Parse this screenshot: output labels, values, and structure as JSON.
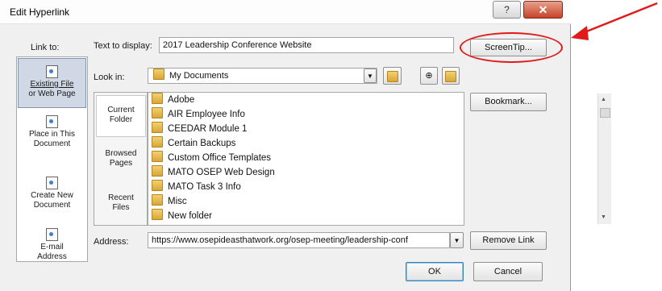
{
  "dialog": {
    "title": "Edit Hyperlink",
    "help_label": "?",
    "close_label": "✕"
  },
  "link_to": {
    "label": "Link to:",
    "items": [
      {
        "label_line1": "Existing File",
        "label_line2": "or Web Page"
      },
      {
        "label_line1": "Place in This",
        "label_line2": "Document"
      },
      {
        "label_line1": "Create New",
        "label_line2": "Document"
      },
      {
        "label_line1": "E-mail",
        "label_line2": "Address"
      }
    ]
  },
  "text_to_display": {
    "label": "Text to display:",
    "value": "2017 Leadership Conference Website"
  },
  "look_in": {
    "label": "Look in:",
    "value": "My Documents"
  },
  "folder_pane": [
    {
      "label_line1": "Current",
      "label_line2": "Folder"
    },
    {
      "label_line1": "Browsed",
      "label_line2": "Pages"
    },
    {
      "label_line1": "Recent",
      "label_line2": "Files"
    }
  ],
  "files": [
    "Adobe",
    "AIR Employee Info",
    "CEEDAR Module 1",
    "Certain Backups",
    "Custom Office Templates",
    "MATO OSEP Web Design",
    "MATO Task 3 Info",
    "Misc",
    "New folder"
  ],
  "address": {
    "label": "Address:",
    "value": "https://www.osepideasthatwork.org/osep-meeting/leadership-conf"
  },
  "buttons": {
    "screentip": "ScreenTip...",
    "bookmark": "Bookmark...",
    "remove_link": "Remove Link",
    "ok": "OK",
    "cancel": "Cancel"
  },
  "colors": {
    "annotation": "#e11a1a"
  }
}
